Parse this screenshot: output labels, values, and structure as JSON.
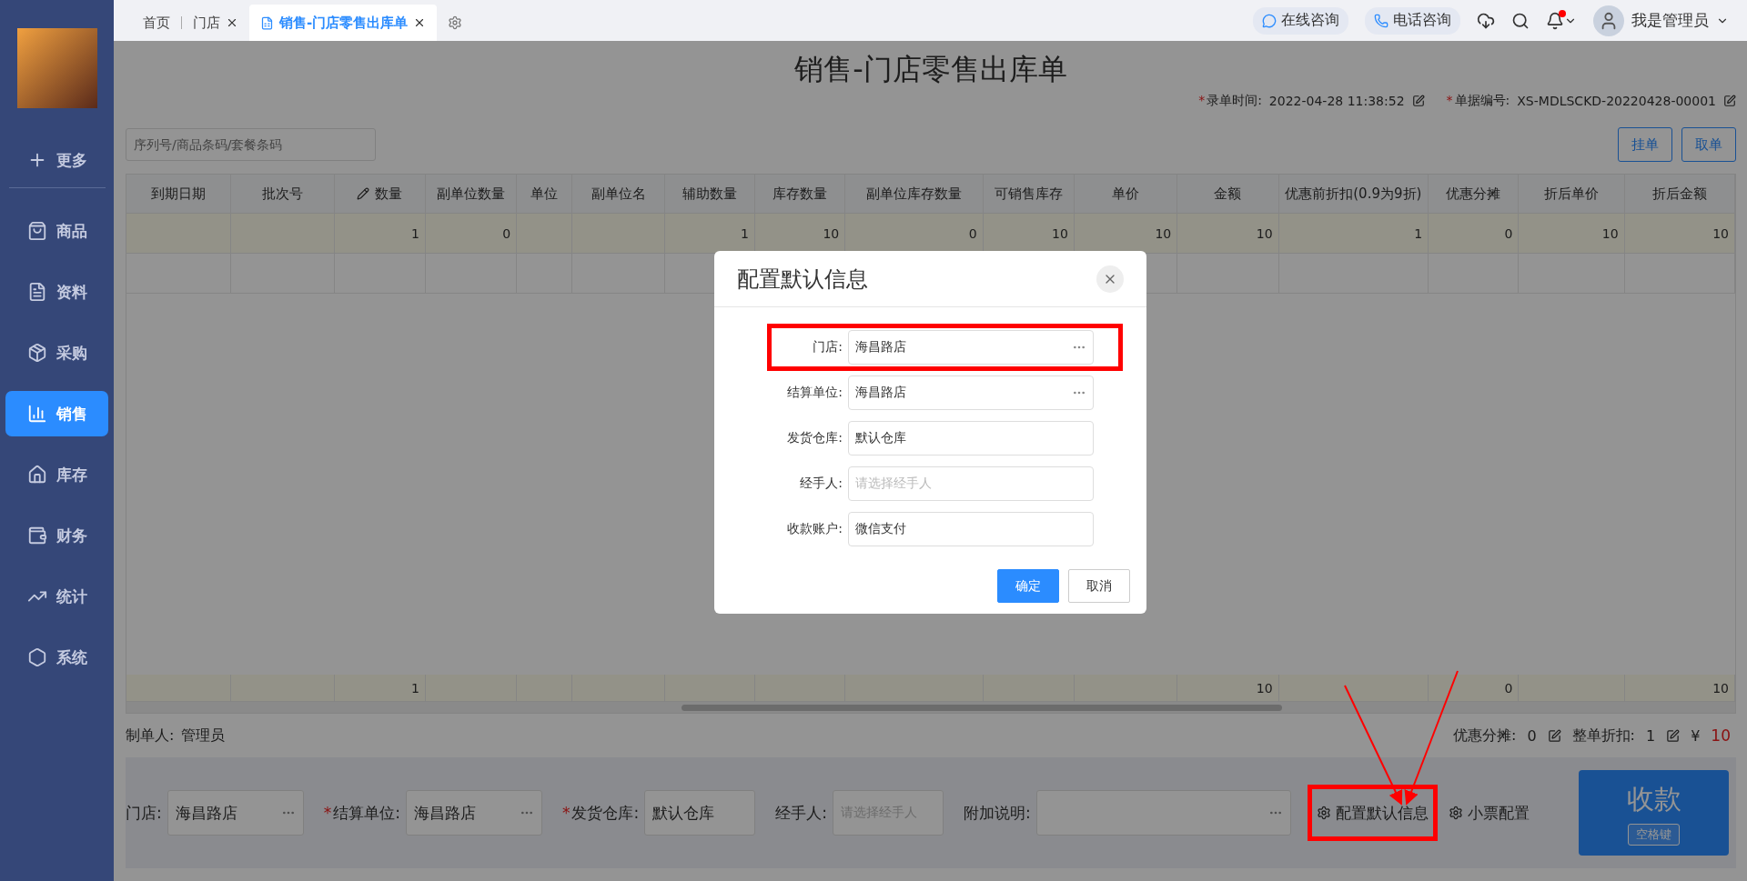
{
  "sidebar": {
    "sections": [
      {
        "items": [
          {
            "label": "更多",
            "selected": false
          }
        ]
      },
      {
        "items": [
          {
            "label": "商品",
            "selected": false
          },
          {
            "label": "资料",
            "selected": false
          },
          {
            "label": "采购",
            "selected": false
          },
          {
            "label": "销售",
            "selected": true
          },
          {
            "label": "库存",
            "selected": false
          },
          {
            "label": "财务",
            "selected": false
          },
          {
            "label": "统计",
            "selected": false
          },
          {
            "label": "系统",
            "selected": false
          }
        ]
      }
    ]
  },
  "tabs": [
    {
      "label": "首页",
      "selected": false,
      "closable": false
    },
    {
      "label": "门店",
      "selected": false,
      "closable": true
    },
    {
      "label": "销售-门店零售出库单",
      "selected": true,
      "closable": true
    }
  ],
  "topbar": {
    "online": "在线咨询",
    "phone": "电话咨询",
    "notification": true,
    "user": "我是管理员"
  },
  "page": {
    "title": "销售-门店零售出库单",
    "meta": [
      {
        "mark": "*",
        "label": "录单时间:",
        "value": "2022-04-28 11:38:52"
      },
      {
        "mark": "*",
        "label": "单据编号:",
        "value": "XS-MDLSCKD-20220428-00001"
      }
    ],
    "search_placeholder": "序列号/商品条码/套餐条码",
    "actions": [
      "挂单",
      "取单"
    ]
  },
  "table": {
    "columns": [
      {
        "label": "到期日期",
        "editable": false
      },
      {
        "label": "批次号",
        "editable": false
      },
      {
        "label": "数量",
        "editable": true
      },
      {
        "label": "副单位数量",
        "editable": false
      },
      {
        "label": "单位",
        "editable": false
      },
      {
        "label": "副单位名",
        "editable": false
      },
      {
        "label": "辅助数量",
        "editable": false
      },
      {
        "label": "库存数量",
        "editable": false
      },
      {
        "label": "副单位库存数量",
        "editable": false
      },
      {
        "label": "可销售库存",
        "editable": false
      },
      {
        "label": "单价",
        "editable": false
      },
      {
        "label": "金额",
        "editable": false
      },
      {
        "label": "优惠前折扣(0.9为9折)",
        "editable": false
      },
      {
        "label": "优惠分摊",
        "editable": false
      },
      {
        "label": "折后单价",
        "editable": false
      },
      {
        "label": "折后金额",
        "editable": false
      }
    ],
    "rows": [
      {
        "selected": true,
        "cells": {
          "c2": "1",
          "c3": "0",
          "c6": "1",
          "c7": "10",
          "c8": "0",
          "c9": "10",
          "c10": "10",
          "c11": "10",
          "c12": "1",
          "c13": "0",
          "c14": "10",
          "c15": "10"
        }
      },
      {
        "selected": false
      }
    ],
    "footer": {
      "c2": "1",
      "c11": "10",
      "c13": "0",
      "c15": "10"
    }
  },
  "summary": {
    "maker_label": "制单人:",
    "maker": "管理员",
    "discount_label": "优惠分摊:",
    "discount": "0",
    "whole_label": "整单折扣:",
    "whole": "1",
    "currency": "¥",
    "total": "10"
  },
  "bottom": {
    "fields": [
      {
        "label": "门店:",
        "value": "海昌路店",
        "kind": "picker"
      },
      {
        "mark": "*",
        "label": "结算单位:",
        "value": "海昌路店",
        "kind": "picker"
      },
      {
        "mark": "*",
        "label": "发货仓库:",
        "value": "默认仓库",
        "kind": "text"
      },
      {
        "label": "经手人:",
        "placeholder": "请选择经手人",
        "kind": "text"
      },
      {
        "label": "附加说明:",
        "kind": "note"
      }
    ],
    "links": [
      {
        "label": "配置默认信息",
        "highlighted": true
      },
      {
        "label": "小票配置"
      }
    ],
    "pay": {
      "label": "收款",
      "key": "空格键"
    }
  },
  "dialog": {
    "title": "配置默认信息",
    "fields": [
      {
        "label": "门店:",
        "value": "海昌路店",
        "picker": true,
        "highlighted": true
      },
      {
        "label": "结算单位:",
        "value": "海昌路店",
        "picker": true
      },
      {
        "label": "发货仓库:",
        "value": "默认仓库",
        "picker": false
      },
      {
        "label": "经手人:",
        "placeholder": "请选择经手人",
        "picker": false
      },
      {
        "label": "收款账户:",
        "value": "微信支付",
        "picker": false
      }
    ],
    "buttons": [
      {
        "label": "确定",
        "primary": true
      },
      {
        "label": "取消",
        "primary": false
      }
    ]
  }
}
